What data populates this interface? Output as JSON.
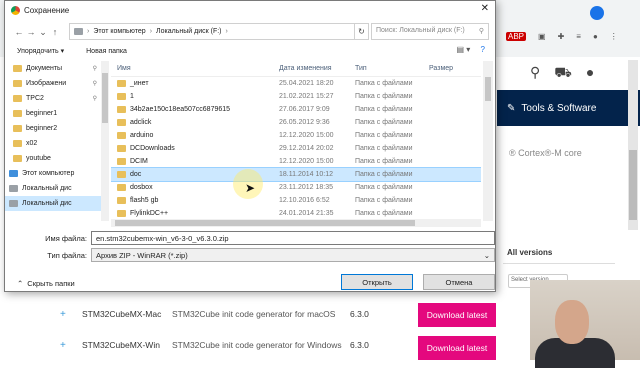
{
  "dialog": {
    "title": "Сохранение",
    "breadcrumb": [
      "Этот компьютер",
      "Локальный диск (F:)"
    ],
    "search_placeholder": "Поиск: Локальный диск (F:)",
    "toolbar": {
      "organize": "Упорядочить ▾",
      "new_folder": "Новая папка"
    },
    "nav_items": [
      {
        "label": "Документы",
        "icon": "folder-icon",
        "pinned": true
      },
      {
        "label": "Изображени",
        "icon": "folder-icon",
        "pinned": true
      },
      {
        "label": "TPC2",
        "icon": "folder-icon",
        "pinned": true
      },
      {
        "label": "beginner1",
        "icon": "folder-icon",
        "pinned": false
      },
      {
        "label": "beginner2",
        "icon": "folder-icon",
        "pinned": false
      },
      {
        "label": "x02",
        "icon": "folder-icon",
        "pinned": false
      },
      {
        "label": "youtube",
        "icon": "folder-icon",
        "pinned": false
      },
      {
        "label": "Этот компьютер",
        "icon": "computer-icon",
        "pinned": false
      },
      {
        "label": "Локальный дис",
        "icon": "drive-icon",
        "pinned": false
      },
      {
        "label": "Локальный дис",
        "icon": "drive-icon",
        "pinned": false,
        "selected": true
      }
    ],
    "columns": {
      "name": "Имя",
      "date": "Дата изменения",
      "type": "Тип",
      "size": "Размер"
    },
    "files": [
      {
        "name": "_инет",
        "date": "25.04.2021 18:20",
        "type": "Папка с файлами"
      },
      {
        "name": "1",
        "date": "21.02.2021 15:27",
        "type": "Папка с файлами"
      },
      {
        "name": "34b2ae150c18ea507cc6879615",
        "date": "27.06.2017 9:09",
        "type": "Папка с файлами"
      },
      {
        "name": "adclick",
        "date": "26.05.2012 9:36",
        "type": "Папка с файлами"
      },
      {
        "name": "arduino",
        "date": "12.12.2020 15:00",
        "type": "Папка с файлами"
      },
      {
        "name": "DCDownloads",
        "date": "29.12.2014 20:02",
        "type": "Папка с файлами"
      },
      {
        "name": "DCIM",
        "date": "12.12.2020 15:00",
        "type": "Папка с файлами"
      },
      {
        "name": "doc",
        "date": "18.11.2014 10:12",
        "type": "Папка с файлами",
        "selected": true
      },
      {
        "name": "dosbox",
        "date": "23.11.2012 18:35",
        "type": "Папка с файлами"
      },
      {
        "name": "flash5 gb",
        "date": "12.10.2016 6:52",
        "type": "Папка с файлами"
      },
      {
        "name": "FlylinkDC++",
        "date": "24.01.2014 21:35",
        "type": "Папка с файлами"
      }
    ],
    "filename_label": "Имя файла:",
    "filename_value": "en.stm32cubemx-win_v6-3-0_v6.3.0.zip",
    "filetype_label": "Тип файла:",
    "filetype_value": "Архив ZIP - WinRAR (*.zip)",
    "hide_folders": "Скрыть папки",
    "save": "Открыть",
    "cancel": "Отмена"
  },
  "site": {
    "nav_label": "Tools & Software",
    "cortex_text": "® Cortex®-M core",
    "all_versions": "All versions",
    "select_version": "Select version",
    "rows": [
      {
        "name": "STM32CubeMX-Mac",
        "desc": "STM32Cube init code generator for macOS",
        "version": "6.3.0",
        "button": "Download latest"
      },
      {
        "name": "STM32CubeMX-Win",
        "desc": "STM32Cube init code generator for Windows",
        "version": "6.3.0",
        "button": "Download latest"
      }
    ]
  },
  "colors": {
    "site_nav": "#03234b",
    "download_button": "#e4087e",
    "selection": "#cce8ff"
  }
}
